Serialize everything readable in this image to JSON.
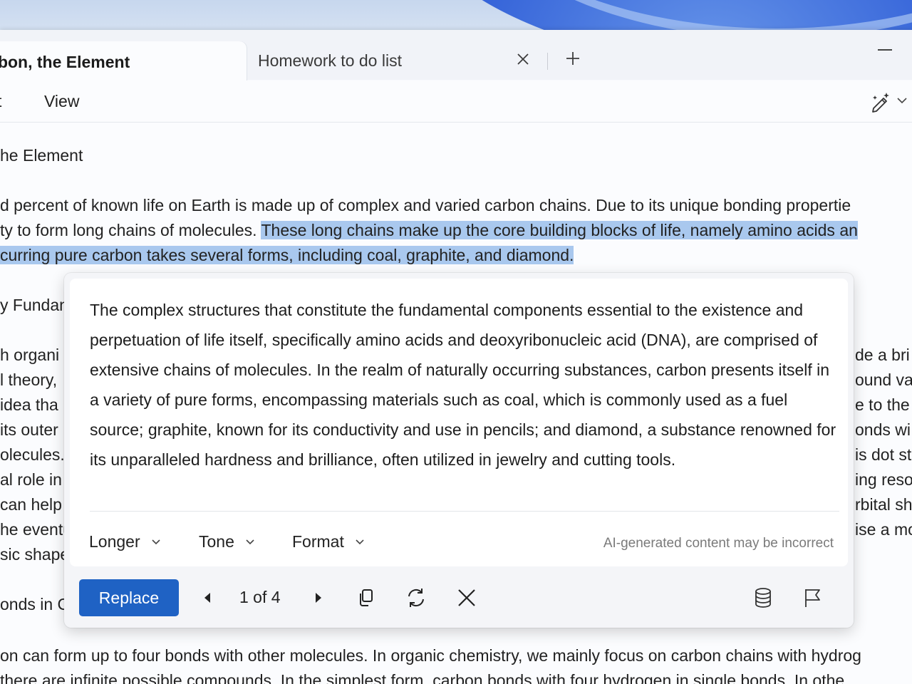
{
  "tabs": {
    "active_title": "rbon, the Element",
    "inactive_title": "Homework to do list",
    "close_icon": "close-icon",
    "new_tab_icon": "plus-icon"
  },
  "menu": {
    "items": [
      "t",
      "View"
    ],
    "copilot_icon": "rewrite-pen-icon"
  },
  "document": {
    "heading": "he Element",
    "para1": {
      "line1": "d percent of known life on Earth is made up of complex and varied carbon chains. Due to its unique bonding propertie",
      "line2_plain": "ty to form long chains of molecules. ",
      "line2_selected": "These long chains make up the core building blocks of life, namely amino acids an",
      "line3_selected": "curring pure carbon takes several forms, including coal, graphite, and diamond."
    },
    "left_fragments": [
      "y Fundan",
      "h organi",
      "l theory,",
      " idea tha",
      "its outer",
      "olecules.",
      "al role in",
      "can help",
      "he eventu",
      "sic shape",
      "onds in C"
    ],
    "right_fragments": [
      "de a bri",
      "ound va",
      "e to the",
      "onds wi",
      "is dot st",
      "ing reso",
      "rbital sh",
      "ise a mo"
    ],
    "bottom_line1": "on can form up to four bonds with other molecules. In organic chemistry, we mainly focus on carbon chains with hydrog",
    "bottom_line2": " there are infinite possible compounds. In the simplest form, carbon bonds with four hydrogen in single bonds. In othe"
  },
  "rewrite_popup": {
    "suggestion": "The complex structures that constitute the fundamental components essential to the existence and perpetuation of life itself, specifically amino acids and deoxyribonucleic acid (DNA), are comprised of extensive chains of molecules. In the realm of naturally occurring substances, carbon presents itself in a variety of pure forms, encompassing materials such as coal, which is commonly used as a fuel source; graphite, known for its conductivity and use in pencils; and diamond, a substance renowned for its unparalleled hardness and brilliance, often utilized in jewelry and cutting tools.",
    "options": [
      "Longer",
      "Tone",
      "Format"
    ],
    "disclaimer": "AI-generated content may be incorrect",
    "replace_label": "Replace",
    "pager": "1 of 4",
    "icons": [
      "previous-icon",
      "next-icon",
      "copy-icon",
      "regenerate-icon",
      "close-icon",
      "database-icon",
      "flag-icon"
    ],
    "accent_color": "#1f62c4"
  }
}
